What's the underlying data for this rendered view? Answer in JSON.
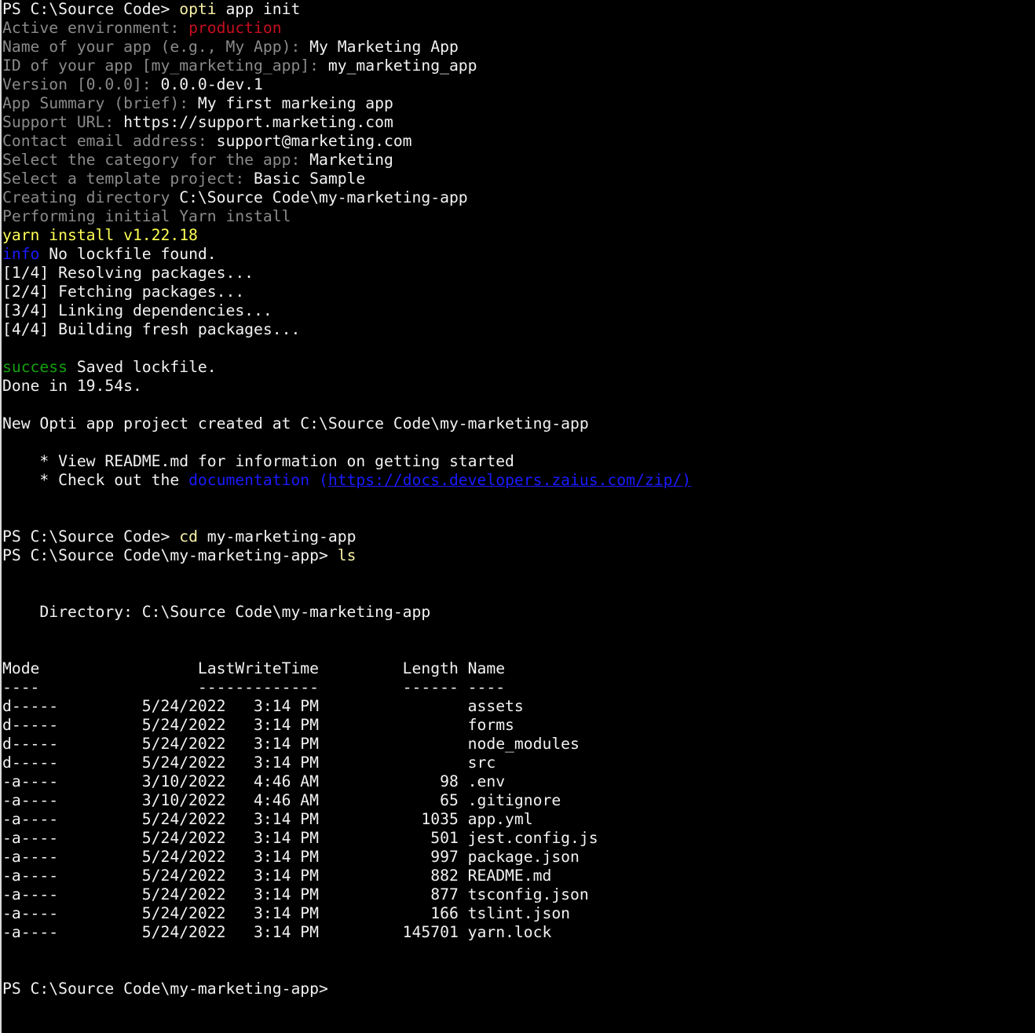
{
  "terminal": {
    "colors": {
      "background": "#000000",
      "foreground": "#f2f2f2",
      "prompt_label": "#8a8a8a",
      "command": "#f9f1a5",
      "error_env": "#c50f1f",
      "info": "#1a1aff",
      "success": "#13a10e",
      "link": "#1a1aff"
    },
    "lines": [
      [
        {
          "t": "PS C:\\Source Code> ",
          "c": "default"
        },
        {
          "t": "opti",
          "c": "yellow"
        },
        {
          "t": " app init",
          "c": "default"
        }
      ],
      [
        {
          "t": "Active environment: ",
          "c": "gray"
        },
        {
          "t": "production",
          "c": "red"
        }
      ],
      [
        {
          "t": "Name of your app (e.g., My App): ",
          "c": "gray"
        },
        {
          "t": "My Marketing App",
          "c": "default"
        }
      ],
      [
        {
          "t": "ID of your app [my_marketing_app]: ",
          "c": "gray"
        },
        {
          "t": "my_marketing_app",
          "c": "default"
        }
      ],
      [
        {
          "t": "Version [0.0.0]: ",
          "c": "gray"
        },
        {
          "t": "0.0.0-dev.1",
          "c": "default"
        }
      ],
      [
        {
          "t": "App Summary (brief): ",
          "c": "gray"
        },
        {
          "t": "My first markeing app",
          "c": "default"
        }
      ],
      [
        {
          "t": "Support URL: ",
          "c": "gray"
        },
        {
          "t": "https://support.marketing.com",
          "c": "default"
        }
      ],
      [
        {
          "t": "Contact email address: ",
          "c": "gray"
        },
        {
          "t": "support@marketing.com",
          "c": "default"
        }
      ],
      [
        {
          "t": "Select the category for the app: ",
          "c": "gray"
        },
        {
          "t": "Marketing",
          "c": "default"
        }
      ],
      [
        {
          "t": "Select a template project: ",
          "c": "gray"
        },
        {
          "t": "Basic Sample",
          "c": "default"
        }
      ],
      [
        {
          "t": "Creating directory ",
          "c": "gray"
        },
        {
          "t": "C:\\Source Code\\my-marketing-app",
          "c": "default"
        }
      ],
      [
        {
          "t": "Performing initial Yarn install",
          "c": "gray"
        }
      ],
      [
        {
          "t": "yarn install v1.22.18",
          "c": "yellow-b"
        }
      ],
      [
        {
          "t": "info",
          "c": "blue"
        },
        {
          "t": " No lockfile found.",
          "c": "default"
        }
      ],
      [
        {
          "t": "[1/4] Resolving packages...",
          "c": "default"
        }
      ],
      [
        {
          "t": "[2/4] Fetching packages...",
          "c": "default"
        }
      ],
      [
        {
          "t": "[3/4] Linking dependencies...",
          "c": "default"
        }
      ],
      [
        {
          "t": "[4/4] Building fresh packages...",
          "c": "default"
        }
      ],
      [],
      [
        {
          "t": "success",
          "c": "green"
        },
        {
          "t": " Saved lockfile.",
          "c": "default"
        }
      ],
      [
        {
          "t": "Done in 19.54s.",
          "c": "default"
        }
      ],
      [],
      [
        {
          "t": "New Opti app project created at C:\\Source Code\\my-marketing-app",
          "c": "default"
        }
      ],
      [],
      [
        {
          "t": "    * View README.md for information on getting started",
          "c": "default"
        }
      ],
      [
        {
          "t": "    * Check out the ",
          "c": "default"
        },
        {
          "t": "documentation (",
          "c": "link"
        },
        {
          "t": "https://docs.developers.zaius.com/zip/",
          "c": "link-u"
        },
        {
          "t": ")",
          "c": "link-u"
        }
      ],
      [],
      [],
      [
        {
          "t": "PS C:\\Source Code> ",
          "c": "default"
        },
        {
          "t": "cd",
          "c": "yellow"
        },
        {
          "t": " my-marketing-app",
          "c": "default"
        }
      ],
      [
        {
          "t": "PS C:\\Source Code\\my-marketing-app> ",
          "c": "default"
        },
        {
          "t": "ls",
          "c": "yellow"
        }
      ],
      [],
      [],
      [
        {
          "t": "    Directory: C:\\Source Code\\my-marketing-app",
          "c": "default"
        }
      ],
      [],
      [],
      [
        {
          "t": "Mode                 LastWriteTime         Length Name",
          "c": "default"
        }
      ],
      [
        {
          "t": "----                 -------------         ------ ----",
          "c": "default"
        }
      ],
      [
        {
          "t": "d-----         5/24/2022   3:14 PM                assets",
          "c": "default"
        }
      ],
      [
        {
          "t": "d-----         5/24/2022   3:14 PM                forms",
          "c": "default"
        }
      ],
      [
        {
          "t": "d-----         5/24/2022   3:14 PM                node_modules",
          "c": "default"
        }
      ],
      [
        {
          "t": "d-----         5/24/2022   3:14 PM                src",
          "c": "default"
        }
      ],
      [
        {
          "t": "-a----         3/10/2022   4:46 AM             98 .env",
          "c": "default"
        }
      ],
      [
        {
          "t": "-a----         3/10/2022   4:46 AM             65 .gitignore",
          "c": "default"
        }
      ],
      [
        {
          "t": "-a----         5/24/2022   3:14 PM           1035 app.yml",
          "c": "default"
        }
      ],
      [
        {
          "t": "-a----         5/24/2022   3:14 PM            501 jest.config.js",
          "c": "default"
        }
      ],
      [
        {
          "t": "-a----         5/24/2022   3:14 PM            997 package.json",
          "c": "default"
        }
      ],
      [
        {
          "t": "-a----         5/24/2022   3:14 PM            882 README.md",
          "c": "default"
        }
      ],
      [
        {
          "t": "-a----         5/24/2022   3:14 PM            877 tsconfig.json",
          "c": "default"
        }
      ],
      [
        {
          "t": "-a----         5/24/2022   3:14 PM            166 tslint.json",
          "c": "default"
        }
      ],
      [
        {
          "t": "-a----         5/24/2022   3:14 PM         145701 yarn.lock",
          "c": "default"
        }
      ],
      [],
      [],
      [
        {
          "t": "PS C:\\Source Code\\my-marketing-app>",
          "c": "default"
        }
      ]
    ]
  }
}
